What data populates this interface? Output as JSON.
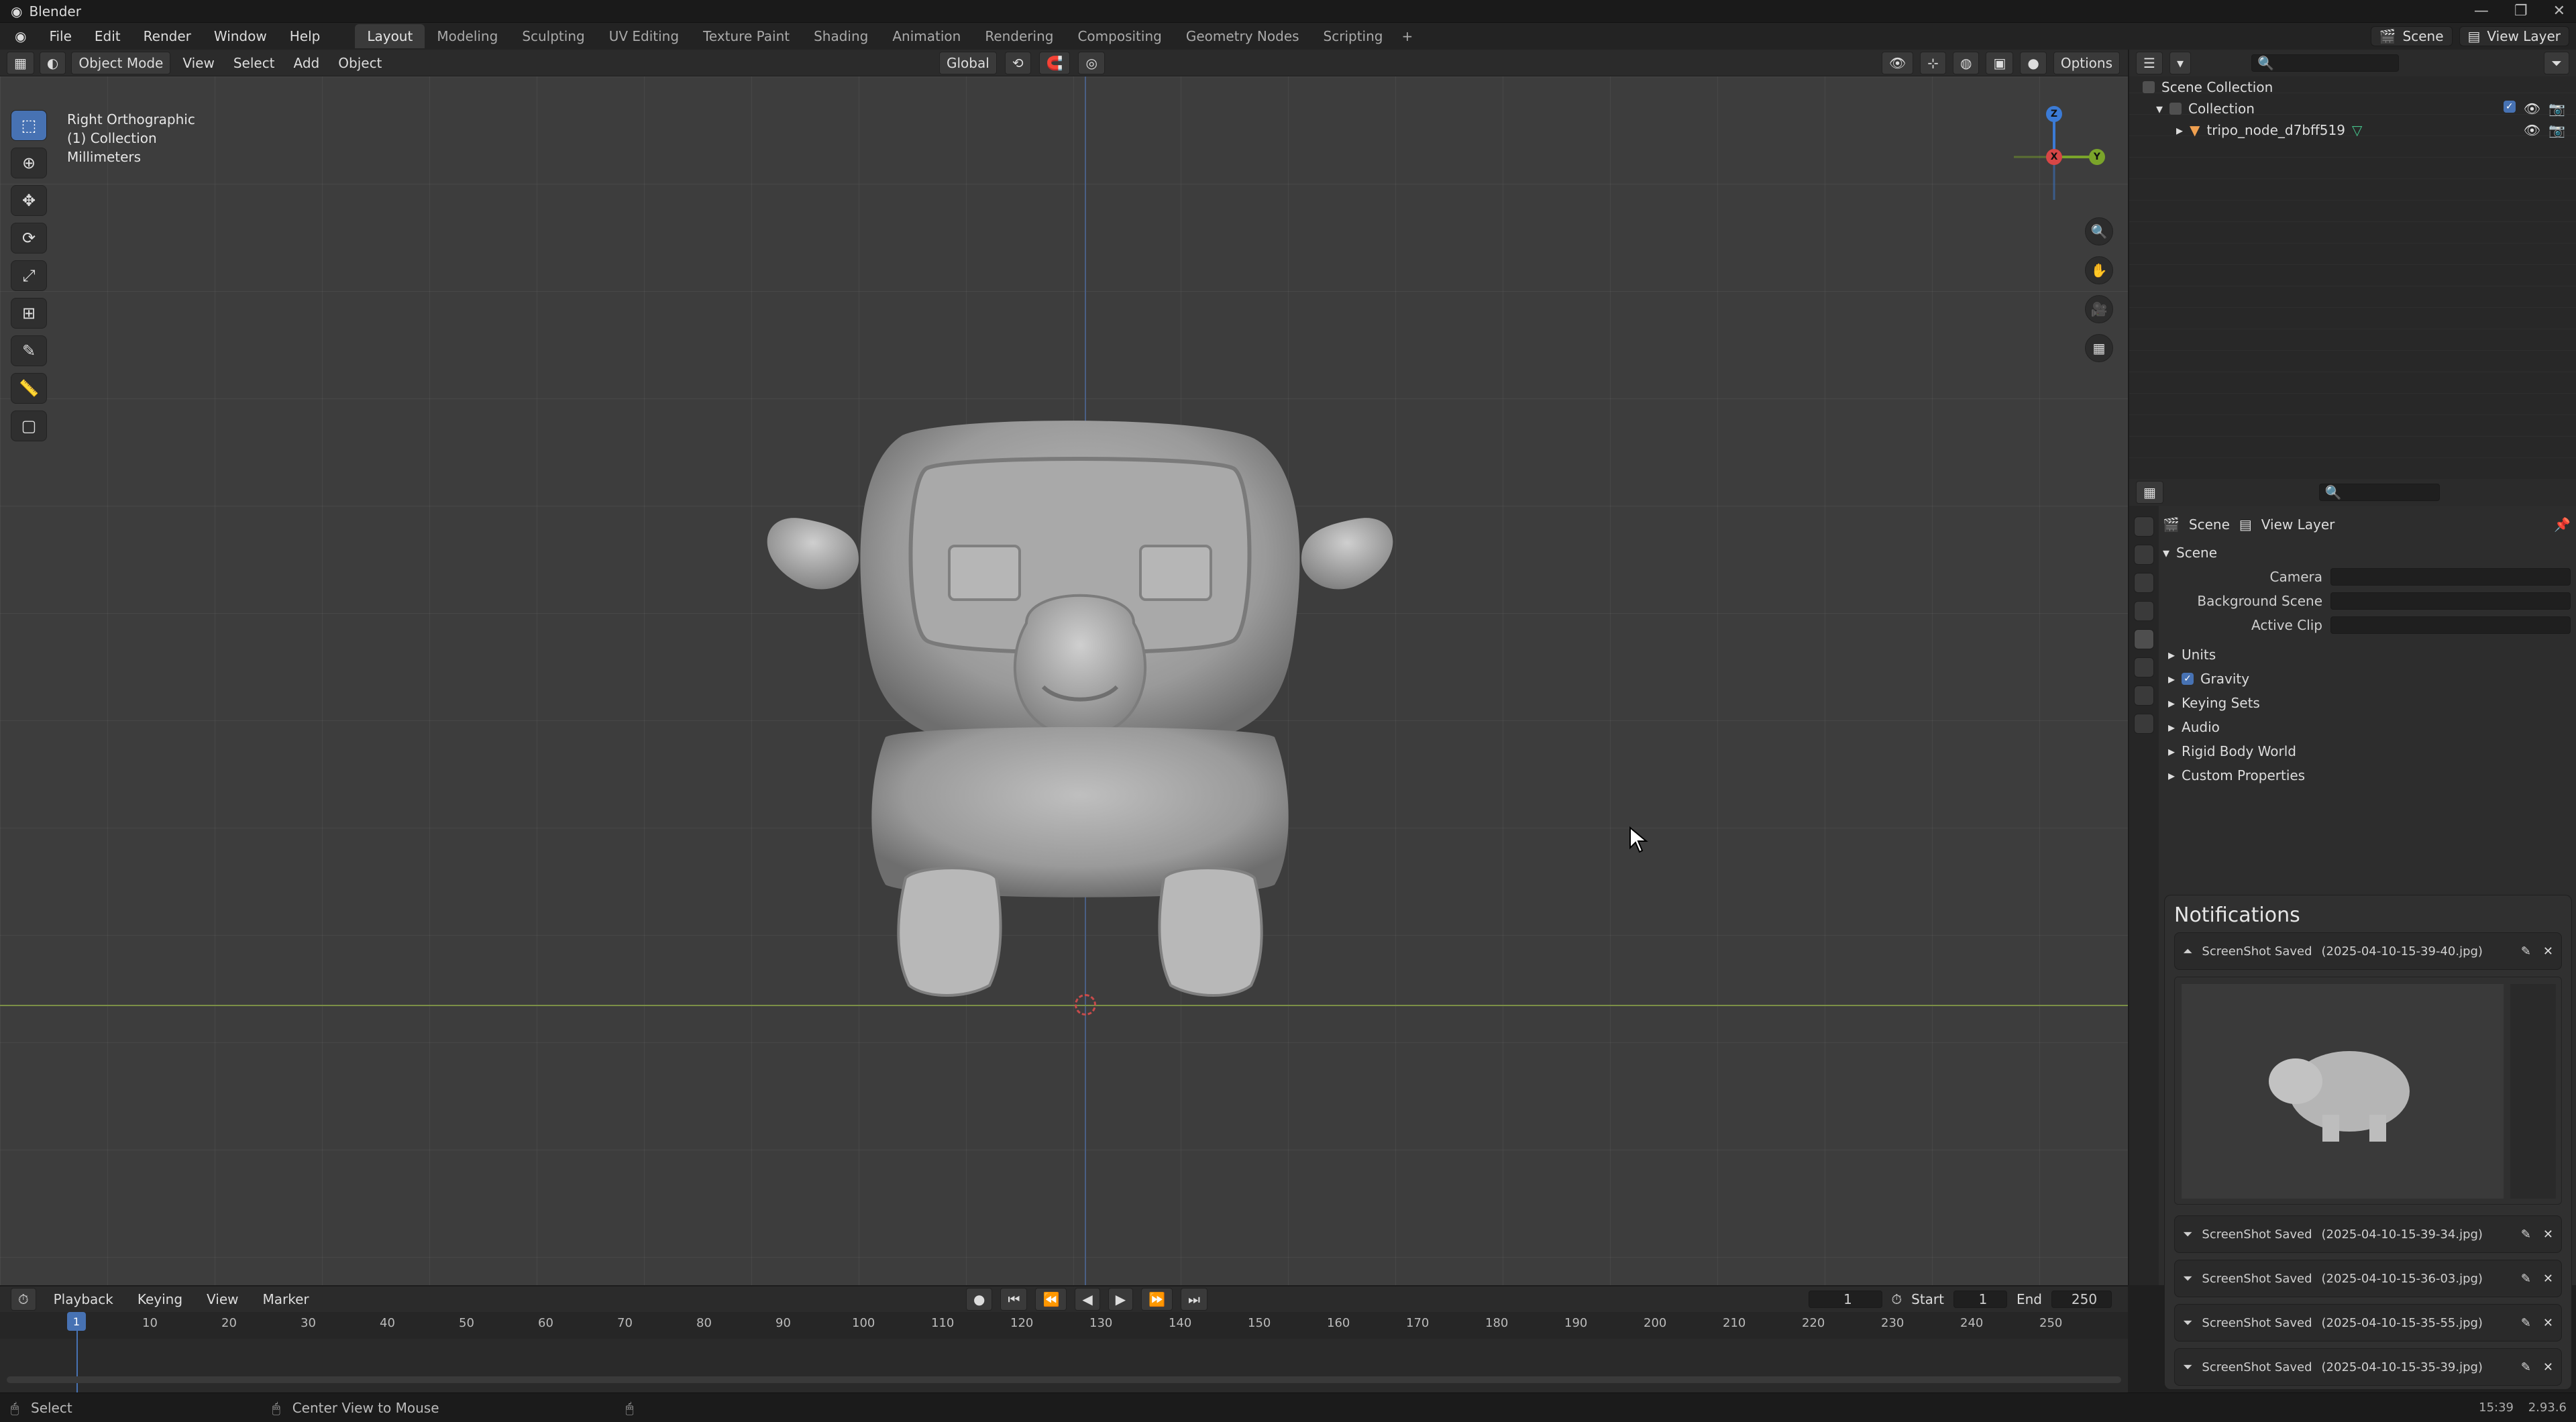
{
  "titlebar": {
    "title": "Blender",
    "window_controls": [
      "—",
      "❐",
      "✕"
    ]
  },
  "menu": {
    "items": [
      "File",
      "Edit",
      "Render",
      "Window",
      "Help"
    ]
  },
  "workspaces": {
    "tabs": [
      "Layout",
      "Modeling",
      "Sculpting",
      "UV Editing",
      "Texture Paint",
      "Shading",
      "Animation",
      "Rendering",
      "Compositing",
      "Geometry Nodes",
      "Scripting"
    ],
    "active": "Layout"
  },
  "scene": {
    "label": "Scene",
    "view_layer": "View Layer"
  },
  "viewport_header": {
    "mode": "Object Mode",
    "menus": [
      "View",
      "Select",
      "Add",
      "Object"
    ],
    "transform_orientation": "Global",
    "options_label": "Options"
  },
  "viewport_info": {
    "view": "Right Orthographic",
    "collection": "(1) Collection",
    "units": "Millimeters"
  },
  "gizmo": {
    "z": "Z",
    "y": "Y",
    "x": "X"
  },
  "outliner": {
    "scene_collection": "Scene Collection",
    "collection": "Collection",
    "object": "tripo_node_d7bff519"
  },
  "properties": {
    "breadcrumb_scene": "Scene",
    "breadcrumb_view_layer": "View Layer",
    "section_scene": "Scene",
    "fields": [
      {
        "label": "Camera",
        "value": ""
      },
      {
        "label": "Background Scene",
        "value": ""
      },
      {
        "label": "Active Clip",
        "value": ""
      }
    ],
    "collapsed_sections": [
      "Units",
      "Gravity",
      "Keying Sets",
      "Audio",
      "Rigid Body World",
      "Custom Properties"
    ],
    "gravity_checked": true
  },
  "notifications": {
    "title": "Notifications",
    "items": [
      {
        "text": "ScreenShot Saved",
        "file": "(2025-04-10-15-39-40.jpg)"
      },
      {
        "text": "ScreenShot Saved",
        "file": "(2025-04-10-15-39-34.jpg)"
      },
      {
        "text": "ScreenShot Saved",
        "file": "(2025-04-10-15-36-03.jpg)"
      },
      {
        "text": "ScreenShot Saved",
        "file": "(2025-04-10-15-35-55.jpg)"
      },
      {
        "text": "ScreenShot Saved",
        "file": "(2025-04-10-15-35-39.jpg)"
      }
    ]
  },
  "timeline": {
    "menus": [
      "Playback",
      "Keying",
      "View",
      "Marker"
    ],
    "current_frame": "1",
    "start_label": "Start",
    "start": "1",
    "end_label": "End",
    "end": "250",
    "ruler": [
      "10",
      "20",
      "30",
      "40",
      "50",
      "60",
      "70",
      "80",
      "90",
      "100",
      "110",
      "120",
      "130",
      "140",
      "150",
      "160",
      "170",
      "180",
      "190",
      "200",
      "210",
      "220",
      "230",
      "240",
      "250"
    ]
  },
  "statusbar": {
    "left_action": "Select",
    "middle_action": "Center View to Mouse",
    "version": "2.93.6",
    "time": "15:39"
  },
  "colors": {
    "accent": "#4772b3",
    "axis_x": "#7b8f47",
    "axis_y": "#4a5f84",
    "gizmo_x": "#d64646",
    "gizmo_y": "#7aa42a",
    "gizmo_z": "#3b7bd6"
  }
}
